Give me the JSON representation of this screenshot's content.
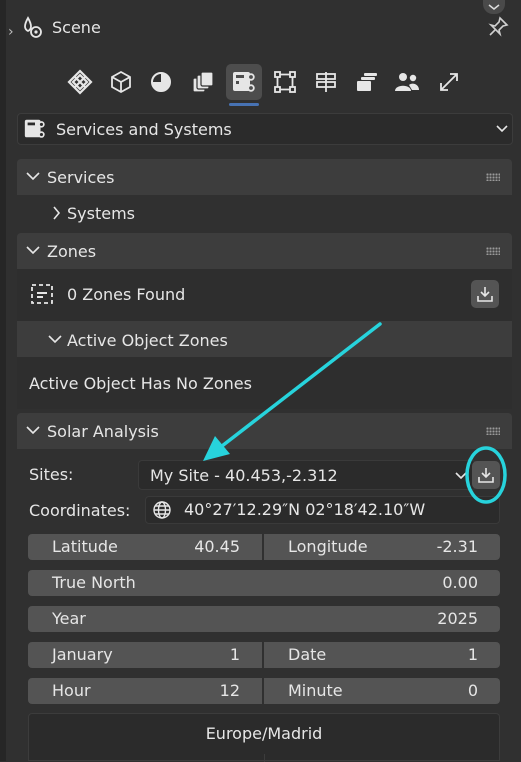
{
  "header": {
    "title": "Scene"
  },
  "tabs": [
    {
      "icon": "bim-logo-icon"
    },
    {
      "icon": "cube-icon"
    },
    {
      "icon": "half-circle-icon"
    },
    {
      "icon": "stack-icon"
    },
    {
      "icon": "services-icon",
      "active": true
    },
    {
      "icon": "structure-icon"
    },
    {
      "icon": "signpost-icon"
    },
    {
      "icon": "layers-icon"
    },
    {
      "icon": "people-icon"
    },
    {
      "icon": "diagonal-arrows-icon"
    }
  ],
  "context_select": {
    "value": "Services and Systems"
  },
  "services": {
    "title": "Services",
    "systems": "Systems"
  },
  "zones": {
    "title": "Zones",
    "found": "0 Zones Found",
    "active_object_zones": "Active Object Zones",
    "no_zones": "Active Object Has No Zones"
  },
  "solar": {
    "title": "Solar Analysis",
    "sites_label": "Sites:",
    "site_value": "My Site - 40.453,-2.312",
    "coordinates_label": "Coordinates:",
    "coordinates_value": "40°27′12.29″N 02°18′42.10″W",
    "latitude_label": "Latitude",
    "latitude_value": "40.45",
    "longitude_label": "Longitude",
    "longitude_value": "-2.31",
    "true_north_label": "True North",
    "true_north_value": "0.00",
    "year_label": "Year",
    "year_value": "2025",
    "month_label": "January",
    "month_value": "1",
    "date_label": "Date",
    "date_value": "1",
    "hour_label": "Hour",
    "hour_value": "12",
    "minute_label": "Minute",
    "minute_value": "0",
    "timezone": "Europe/Madrid"
  },
  "annotation": {
    "color": "#27d3dc"
  }
}
